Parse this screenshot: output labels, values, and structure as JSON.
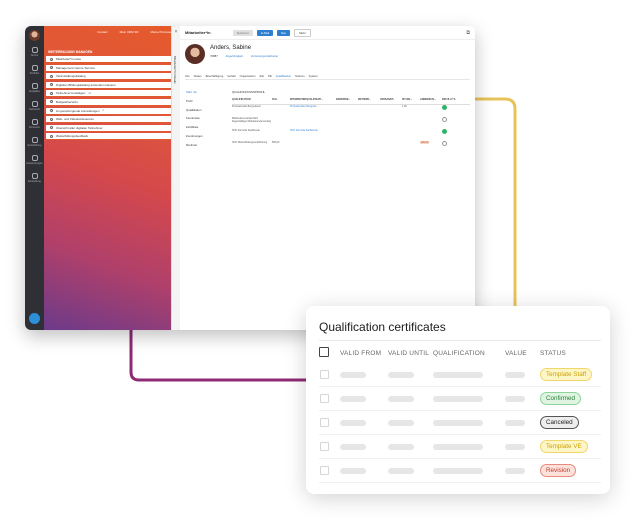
{
  "colors": {
    "accent_orange": "#e55a2b",
    "accent_purple": "#6c3a8a",
    "connector_purple": "#8f2a74",
    "connector_yellow": "#e8c35a",
    "link_blue": "#2d7fd0"
  },
  "app": {
    "rail": {
      "items": [
        {
          "icon": "search-icon",
          "label": "Suche"
        },
        {
          "icon": "folder-icon",
          "label": "Portfolio"
        },
        {
          "icon": "bell-icon",
          "label": "Aufgaben"
        },
        {
          "icon": "network-icon",
          "label": "Netzwerk"
        },
        {
          "icon": "user-icon",
          "label": "Personen"
        },
        {
          "icon": "star-icon",
          "label": "Entwicklung"
        },
        {
          "icon": "chart-icon",
          "label": "Auswertungen"
        },
        {
          "icon": "gear-icon",
          "label": "Einstellung"
        }
      ]
    },
    "topnav": [
      "Contact",
      "Mein CRM 3D",
      "Meine Prozesse"
    ],
    "menu_title": "WEITERBILDUNG MANAGEN",
    "menu": [
      {
        "label": "Mitarbeiter*in-Liste",
        "badge": ""
      },
      {
        "label": "Management interne Termine",
        "badge": ""
      },
      {
        "label": "Veranstaltungskatalog",
        "badge": ""
      },
      {
        "label": "Digitalen Bildungskatalog anwenden Hausen",
        "badge": ""
      },
      {
        "label": "Teilnehmer bestätigen",
        "badge": "22"
      },
      {
        "label": "Budgetübersicht",
        "badge": ""
      },
      {
        "label": "Zu genehmigende Anmeldungen",
        "badge": "3"
      },
      {
        "label": "Web- und Videokonferenzen",
        "badge": ""
      },
      {
        "label": "Übersicht aller digitalen Teilnehmer",
        "badge": ""
      },
      {
        "label": "Weiterbildungsfeedback",
        "badge": ""
      }
    ],
    "side_tab": "Mitarbeiter*in Details",
    "header": {
      "title": "Mitarbeiter*in",
      "btn_grey": "Speichern",
      "btn_blue1": "E-Mail",
      "btn_blue2": "Neu",
      "btn_more": "Mehr"
    },
    "profile": {
      "name": "Anders, Sabine",
      "id": "70887",
      "link1": "Zugehörigkeit",
      "link2": "Vertretungsmitarbeiter"
    },
    "tabs": [
      "Info",
      "Status",
      "Beschäftigung",
      "Gehalt",
      "Organisation",
      "Ziel",
      "PE",
      "Qualifikation",
      "Notizen",
      "System"
    ],
    "active_tab": "Qualifikation",
    "subnav": [
      "Start ‘da’",
      "Profil",
      "Qualifikation",
      "Kenntnisse",
      "Zertifikate",
      "Zuordnungen",
      "Merkmal"
    ],
    "qual_title": "QUALIFIKATIONSPROFIL",
    "qual_headers": [
      "QUALIFIKATION",
      "ZUG.",
      "MITARBEITERQUALIFIKATI...",
      "ERWORBE...",
      "WEITERB...",
      "VERSANDT...",
      "IST-WE...",
      "ANMERKUN...",
      "ERFÜLLT %"
    ],
    "qual_rows": [
      {
        "name": "Professionelle Bergrednern",
        "zug": "",
        "ma": "Professioneller Bergrede...",
        "ist": "1,00",
        "anm": "",
        "ok": true
      },
      {
        "name": "Mitarbeiterverantwortlich Regelmäßiger Mitarbeitendenzertrag",
        "zug": "",
        "ma": "",
        "ist": "",
        "anm": "",
        "ok": false
      },
      {
        "name": "SOC Formelle Sachkunde",
        "zug": "",
        "ma": "SOC Formelle Sachkunde",
        "ist": "",
        "anm": "",
        "ok": true
      },
      {
        "name": "SOC Weiterbildungsverpflichtung",
        "zug": "500,00",
        "ma": "",
        "ist": "",
        "anm": "200,00",
        "ok": false
      }
    ]
  },
  "card": {
    "title": "Qualification certificates",
    "columns": [
      "VALID FROM",
      "VALID UNTIL",
      "QUALIFICATION",
      "VALUE",
      "STATUS"
    ],
    "rows": [
      {
        "status": "Template Staff",
        "bg": "#fff6c8",
        "fg": "#c9a200",
        "border": "#f1d66a"
      },
      {
        "status": "Confirmed",
        "bg": "#dff5e2",
        "fg": "#2a7d3a",
        "border": "#8ed39b"
      },
      {
        "status": "Canceled",
        "bg": "#eeeeee",
        "fg": "#222222",
        "border": "#555555"
      },
      {
        "status": "Template VE",
        "bg": "#fff6c8",
        "fg": "#c9a200",
        "border": "#f1d66a"
      },
      {
        "status": "Revision",
        "bg": "#fde2dc",
        "fg": "#c0392b",
        "border": "#e58a7c"
      }
    ]
  }
}
